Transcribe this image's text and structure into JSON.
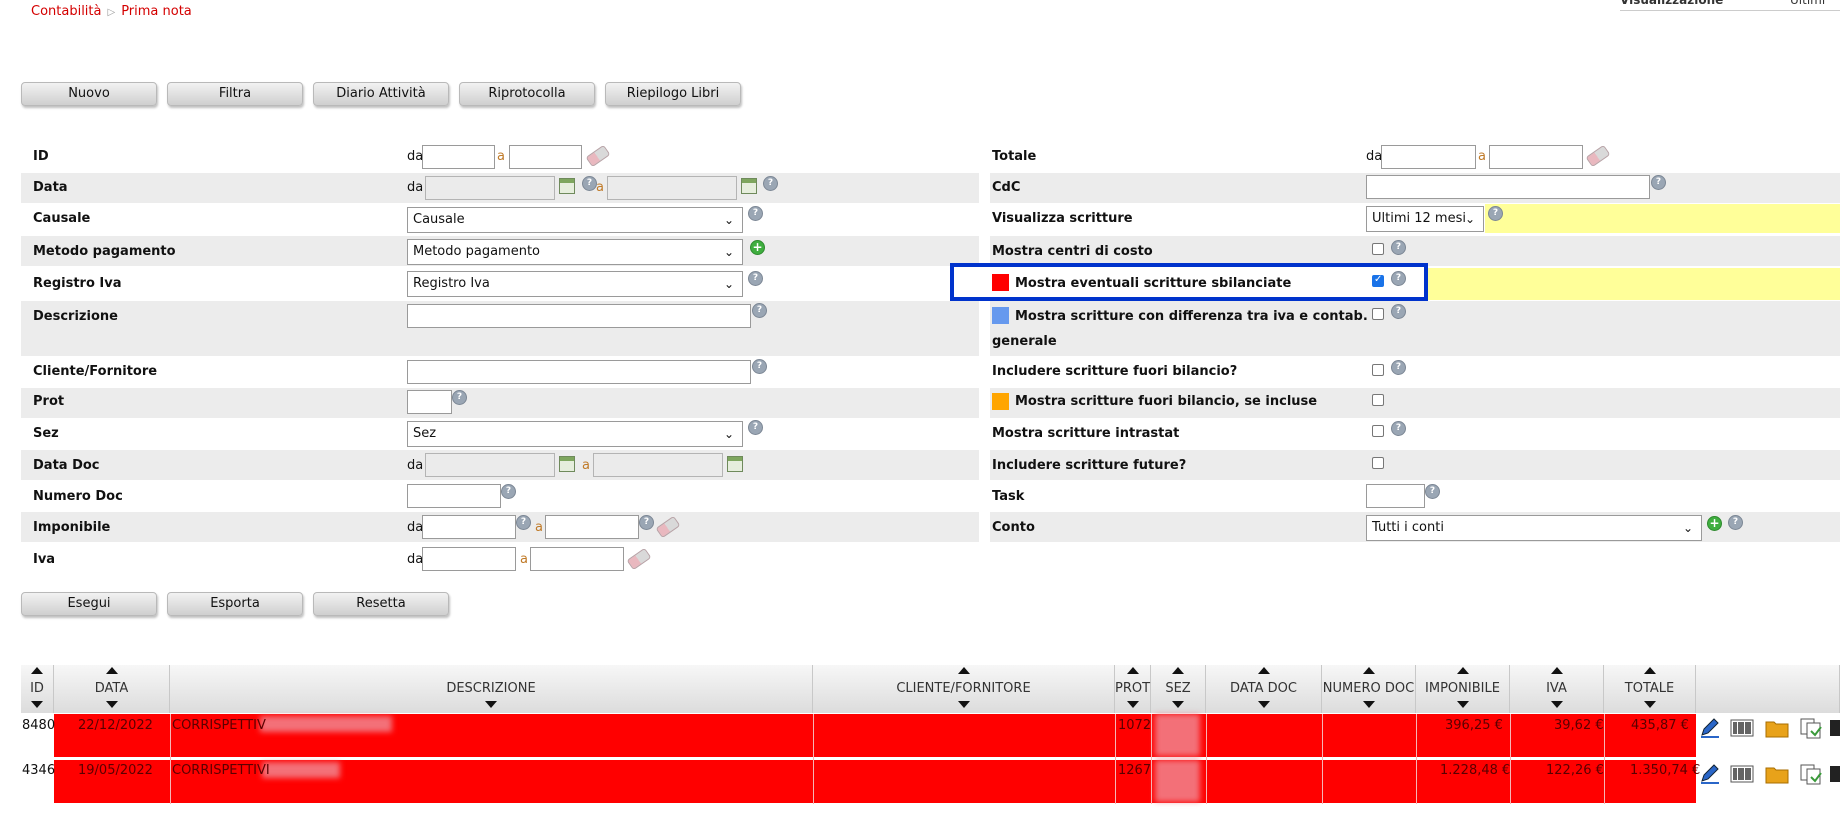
{
  "breadcrumb": {
    "parent": "Contabilità",
    "current": "Prima nota"
  },
  "top_right": {
    "label": "Visualizzazione",
    "value": "Ultimi"
  },
  "toolbar": [
    {
      "label": "Nuovo"
    },
    {
      "label": "Filtra"
    },
    {
      "label": "Diario Attività"
    },
    {
      "label": "Riprotocolla"
    },
    {
      "label": "Riepilogo Libri"
    }
  ],
  "filters": {
    "da": "da",
    "a": "a",
    "id": "ID",
    "data": "Data",
    "causale": "Causale",
    "causale_value": "Causale",
    "metodo": "Metodo pagamento",
    "metodo_value": "Metodo pagamento",
    "registro": "Registro Iva",
    "registro_value": "Registro Iva",
    "descrizione": "Descrizione",
    "cliente": "Cliente/Fornitore",
    "prot": "Prot",
    "sez": "Sez",
    "sez_value": "Sez",
    "data_doc": "Data Doc",
    "numero_doc": "Numero Doc",
    "imponibile": "Imponibile",
    "iva": "Iva",
    "totale": "Totale",
    "cdc": "CdC",
    "visualizza": "Visualizza scritture",
    "visualizza_value": "Ultimi 12 mesi",
    "centri_costo": "Mostra centri di costo",
    "sbilanciate": "Mostra eventuali scritture sbilanciate",
    "differenza": "Mostra scritture con differenza tra iva e contab.",
    "differenza_2": "generale",
    "fuori_bilancio": "Includere scritture fuori bilancio?",
    "fuori_bilancio_show": "Mostra scritture fuori bilancio, se incluse",
    "intrastat": "Mostra scritture intrastat",
    "future": "Includere scritture future?",
    "task": "Task",
    "conto": "Conto",
    "conto_value": "Tutti i conti"
  },
  "actions": [
    {
      "label": "Esegui"
    },
    {
      "label": "Esporta"
    },
    {
      "label": "Resetta"
    }
  ],
  "colors": {
    "red": "#ff0000",
    "blue": "#6699ee",
    "orange": "#ffa500",
    "highlight": "#0033cc",
    "yellow": "#ffff99"
  },
  "table": {
    "headers": [
      "ID",
      "DATA",
      "DESCRIZIONE",
      "CLIENTE/FORNITORE",
      "PROT",
      "SEZ",
      "DATA DOC",
      "NUMERO DOC",
      "IMPONIBILE",
      "IVA",
      "TOTALE"
    ],
    "rows": [
      {
        "id": "8480",
        "data": "22/12/2022",
        "descrizione": "CORRISPETTIV",
        "prot": "1072",
        "imponibile": "396,25 €",
        "iva": "39,62 €",
        "totale": "435,87 €"
      },
      {
        "id": "4346",
        "data": "19/05/2022",
        "descrizione": "CORRISPETTIVI",
        "prot": "1267",
        "imponibile": "1.228,48 €",
        "iva": "122,26 €",
        "totale": "1.350,74 €"
      }
    ],
    "row_icons": [
      "edit-icon",
      "barcode-icon",
      "folder-icon",
      "duplicate-icon",
      "print-icon"
    ]
  }
}
